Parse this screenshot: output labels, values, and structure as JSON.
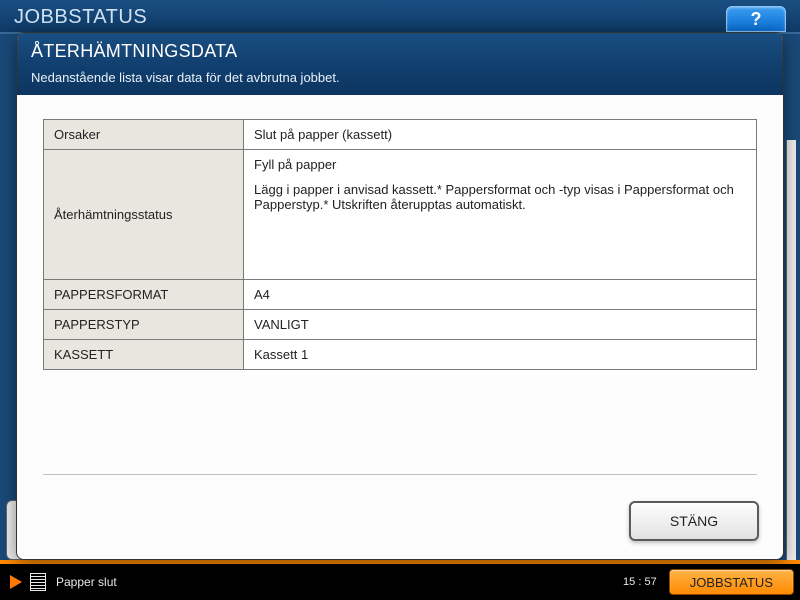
{
  "bgHeader": "JOBBSTATUS",
  "helpLabel": "?",
  "modal": {
    "title": "ÅTERHÄMTNINGSDATA",
    "subtitle": "Nedanstående lista visar data för det avbrutna jobbet.",
    "rows": {
      "causesLabel": "Orsaker",
      "causesValue": "Slut på papper (kassett)",
      "recovLabel": "Återhämtningsstatus",
      "recovLine1": "Fyll på papper",
      "recovLine2": "Lägg i papper i anvisad kassett.* Pappersformat och -typ visas i Pappersformat och Papperstyp.* Utskriften återupptas automatiskt.",
      "formatLabel": "PAPPERSFORMAT",
      "formatValue": "A4",
      "typeLabel": "PAPPERSTYP",
      "typeValue": "VANLIGT",
      "trayLabel": "KASSETT",
      "trayValue": "Kassett 1"
    },
    "closeLabel": "STÄNG"
  },
  "status": {
    "message": "Papper slut",
    "time": "15 : 57",
    "jobstatusBtn": "JOBBSTATUS"
  }
}
